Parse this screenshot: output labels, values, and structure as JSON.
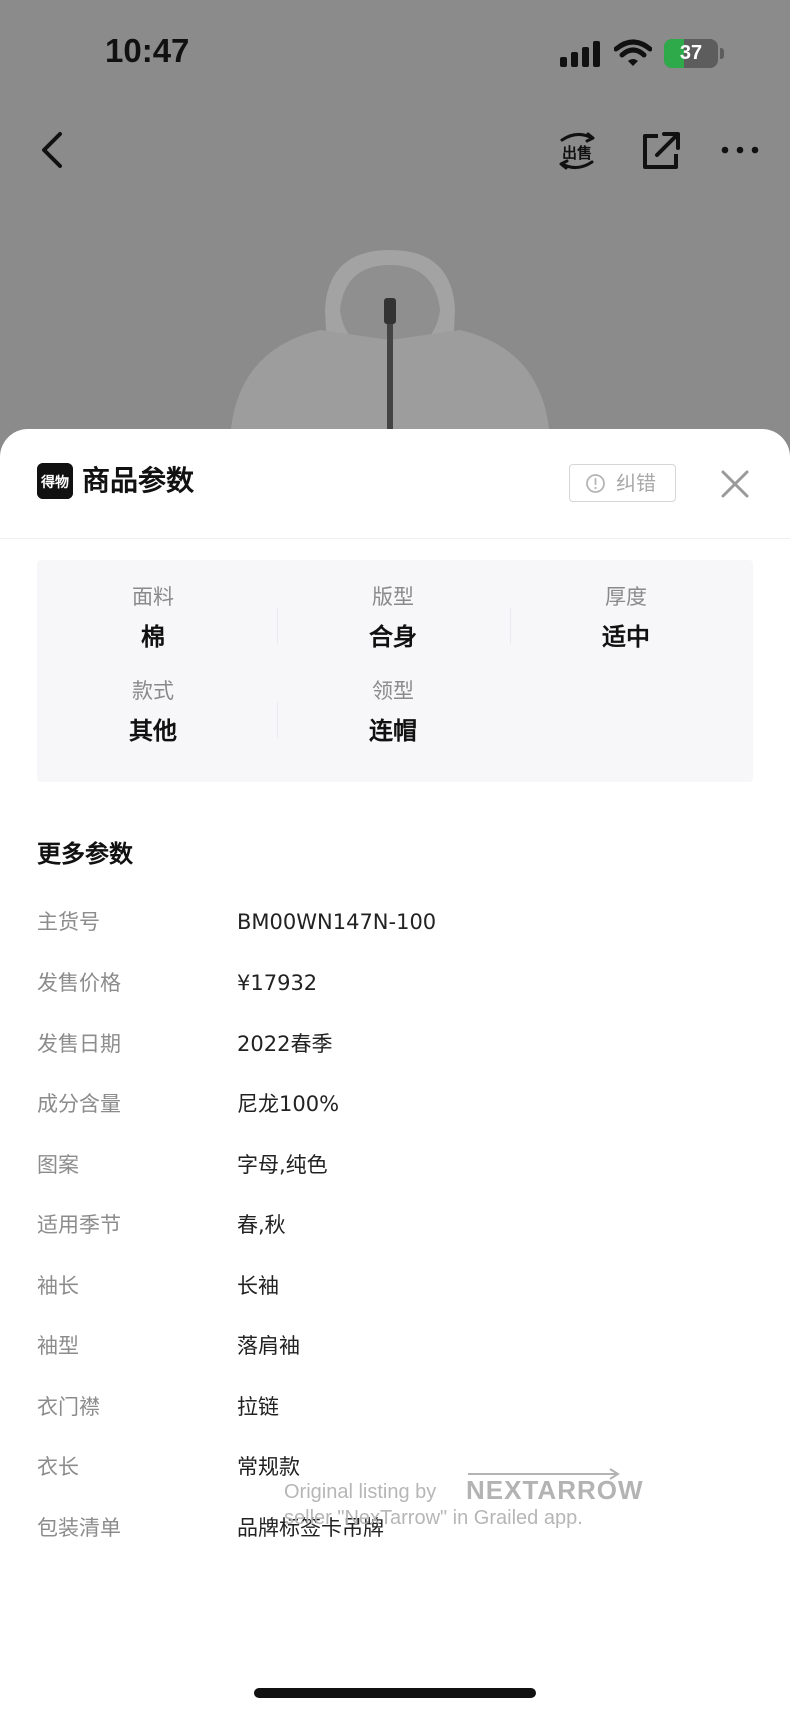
{
  "status_bar": {
    "time": "10:47",
    "battery_percent": "37",
    "battery_level": 0.37,
    "charging": true
  },
  "nav": {
    "icons": [
      "back-icon",
      "sell-icon",
      "share-icon",
      "more-icon"
    ],
    "sell_label": "出售"
  },
  "sheet": {
    "brand_logo_text": "得物",
    "title": "商品参数",
    "report_label": "纠错",
    "specs": [
      {
        "label": "面料",
        "value": "棉"
      },
      {
        "label": "版型",
        "value": "合身"
      },
      {
        "label": "厚度",
        "value": "适中"
      },
      {
        "label": "款式",
        "value": "其他"
      },
      {
        "label": "领型",
        "value": "连帽"
      }
    ],
    "more_title": "更多参数",
    "params": [
      {
        "label": "主货号",
        "value": "BM00WN147N-100"
      },
      {
        "label": "发售价格",
        "value": "¥17932"
      },
      {
        "label": "发售日期",
        "value": "2022春季"
      },
      {
        "label": "成分含量",
        "value": "尼龙100%"
      },
      {
        "label": "图案",
        "value": "字母,纯色"
      },
      {
        "label": "适用季节",
        "value": "春,秋"
      },
      {
        "label": "袖长",
        "value": "长袖"
      },
      {
        "label": "袖型",
        "value": "落肩袖"
      },
      {
        "label": "衣门襟",
        "value": "拉链"
      },
      {
        "label": "衣长",
        "value": "常规款"
      },
      {
        "label": "包装清单",
        "value": "品牌标签卡吊牌"
      }
    ]
  },
  "watermark": {
    "line1": "Original listing by",
    "logo_text": "NEXTARROW",
    "line2": "seller \"NexTarrow\" in Grailed app."
  },
  "colors": {
    "backdrop": "#8b8b8b",
    "sheet": "#ffffff",
    "spec_panel": "#f7f7f9",
    "label_gray": "#8c8c8c",
    "battery_green": "#2faa4a"
  }
}
